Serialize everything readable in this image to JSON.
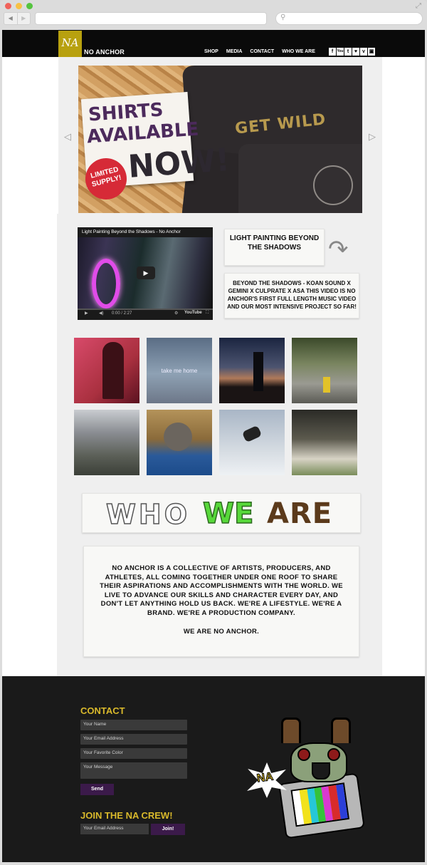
{
  "site": {
    "brand": "NO ANCHOR",
    "logo_text": "NA",
    "menu": [
      "SHOP",
      "MEDIA",
      "CONTACT",
      "WHO WE ARE"
    ],
    "social_icons": [
      "f",
      "You",
      "t",
      "♥",
      "v",
      "▣"
    ]
  },
  "hero": {
    "headline_1": "SHIRTS",
    "headline_2": "AVAILABLE",
    "headline_3": "NOW!",
    "badge_1": "LIMITED",
    "badge_2": "SUPPLY!",
    "shirt_print": "GET WILD",
    "prev_arrow": "◁",
    "next_arrow": "▷"
  },
  "video": {
    "title": "Light Painting Beyond the Shadows - No Anchor",
    "time": "0:00 / 2:27",
    "provider": "YouTube",
    "play_icon": "▶"
  },
  "feature": {
    "title": "LIGHT PAINTING BEYOND THE SHADOWS",
    "description": "BEYOND THE SHADOWS - KOAN SOUND X GEMINI X CULPRATE X ASA THIS VIDEO IS NO ANCHOR'S FIRST FULL LENGTH MUSIC VIDEO AND OUR MOST INTENSIVE PROJECT SO FAR!",
    "arrow": "↷"
  },
  "gallery": {
    "tile_2_caption": "take me home"
  },
  "about": {
    "heading_1": "WHO",
    "heading_2": "WE",
    "heading_3": "ARE",
    "paragraph": "NO ANCHOR IS A COLLECTIVE OF ARTISTS, PRODUCERS, AND ATHLETES, ALL COMING TOGETHER UNDER ONE ROOF TO SHARE THEIR ASPIRATIONS AND ACCOMPLISHMENTS WITH THE WORLD. WE LIVE TO ADVANCE OUR SKILLS AND CHARACTER EVERY DAY, AND DON'T LET ANYTHING HOLD US BACK. WE'RE A LIFESTYLE. WE'RE A BRAND. WE'RE A PRODUCTION COMPANY.",
    "tagline": "WE ARE NO ANCHOR."
  },
  "contact": {
    "heading": "CONTACT",
    "name_placeholder": "Your Name",
    "email_placeholder": "Your Email Address",
    "color_placeholder": "Your Favorite Color",
    "message_placeholder": "Your Message",
    "send_label": "Send"
  },
  "join": {
    "heading": "JOIN THE NA CREW!",
    "email_placeholder": "Your Email Address",
    "button_label": "Join!"
  },
  "mascot": {
    "burst_text": "NA"
  },
  "colors": {
    "accent_gold": "#d9b92b",
    "button_purple": "#3b1a4a",
    "nav_black": "#0a0a0a",
    "footer_bg": "#1a1a1a"
  }
}
